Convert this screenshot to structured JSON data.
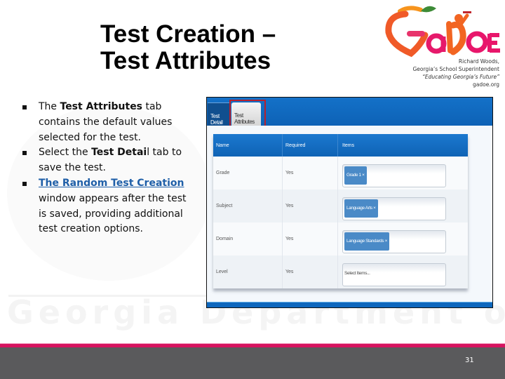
{
  "slide": {
    "title_line1": "Test Creation –",
    "title_line2": "Test Attributes",
    "page_number": "31"
  },
  "logo": {
    "brand": "GaDOE",
    "caption_line1": "Richard Woods,",
    "caption_line2": "Georgia’s School Superintendent",
    "caption_line3": "“Educating Georgia’s Future”",
    "caption_line4": "gadoe.org",
    "colors": {
      "orange": "#f26522",
      "magenta": "#e0115f",
      "green": "#5a9e2f"
    }
  },
  "watermark": "Georgia Department of Education",
  "bullets": [
    {
      "pre": "The ",
      "bold": "Test Attributes",
      "post": " tab contains the default values selected for the test."
    },
    {
      "pre": "Select the ",
      "bold": "Test Detai",
      "post": "l tab to save the test."
    },
    {
      "link": "The Random Test Creation",
      "post": " window appears after the test is saved, providing additional test creation options."
    }
  ],
  "app": {
    "tabs": [
      {
        "label": "Test Detail",
        "active": false
      },
      {
        "label": "Test Attributes",
        "active": true,
        "highlighted": true
      }
    ],
    "table": {
      "headers": [
        "Name",
        "Required",
        "Items"
      ],
      "rows": [
        {
          "name": "Grade",
          "required": "Yes",
          "items": [
            "Grade 1 ×"
          ],
          "placeholder": ""
        },
        {
          "name": "Subject",
          "required": "Yes",
          "items": [
            "Language Arts ×"
          ],
          "placeholder": ""
        },
        {
          "name": "Domain",
          "required": "Yes",
          "items": [
            "Language Standards ×"
          ],
          "placeholder": ""
        },
        {
          "name": "Level",
          "required": "Yes",
          "items": [],
          "placeholder": "Select Items..."
        }
      ]
    },
    "colors": {
      "header_blue": "#0f63b5",
      "chip_blue": "#4a8ac7",
      "highlight_red": "#b4202f"
    }
  },
  "footer": {
    "accent": "#d6135f",
    "bar": "#5a5a5c"
  }
}
